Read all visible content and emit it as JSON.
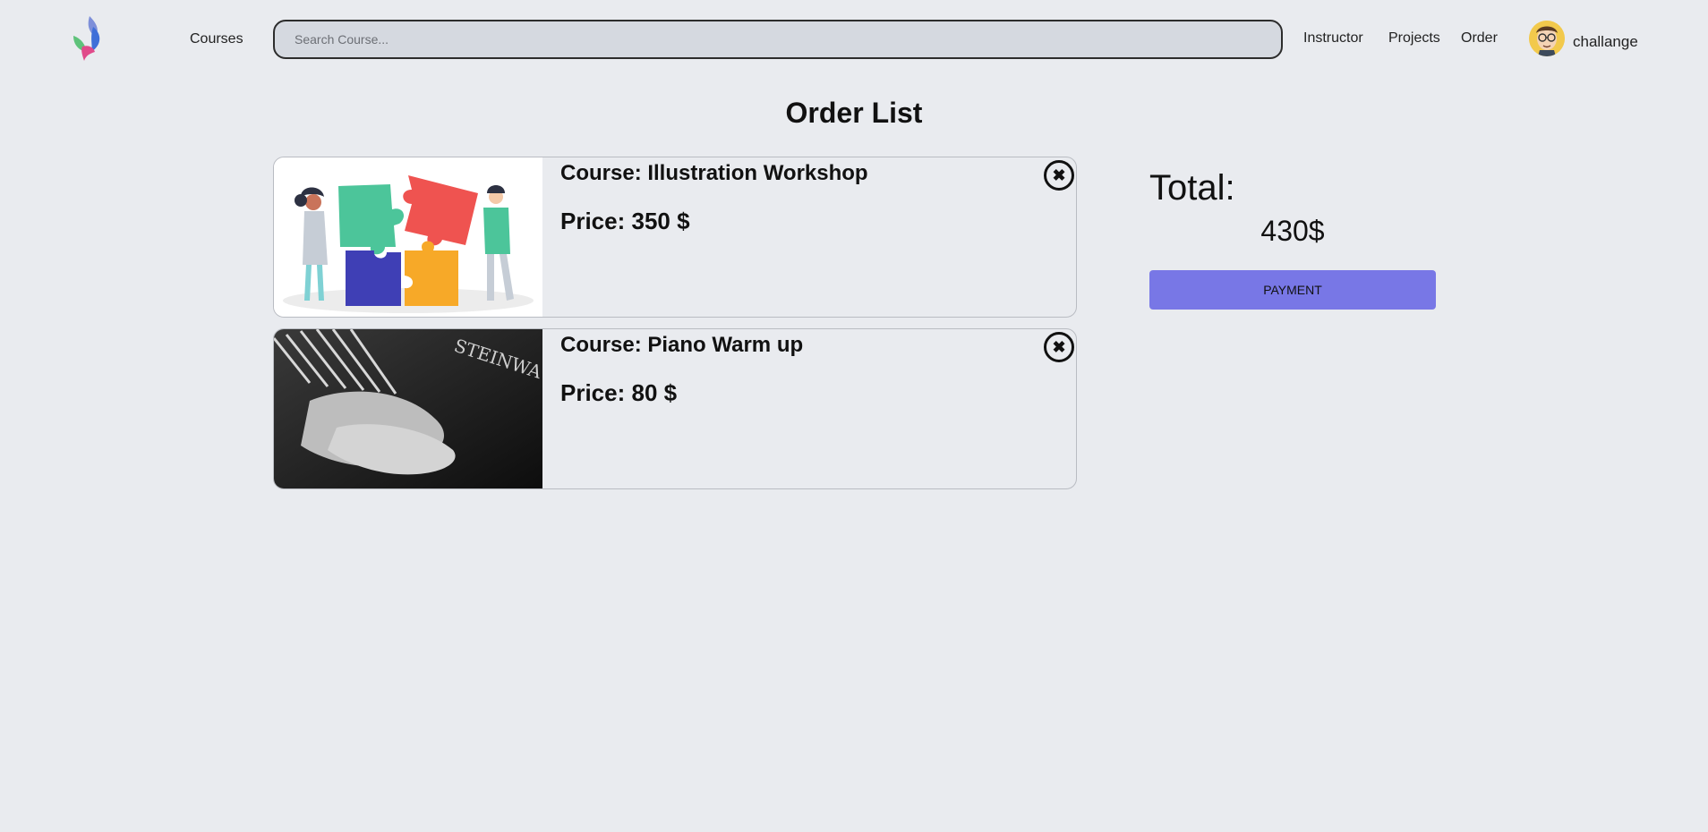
{
  "nav": {
    "courses_label": "Courses",
    "search_placeholder": "Search Course...",
    "search_value": "",
    "instructor_label": "Instructor",
    "projects_label": "Projects",
    "order_label": "Order",
    "username": "challange",
    "logo_icon": "flame-logo-icon",
    "avatar_icon": "user-avatar"
  },
  "page": {
    "title": "Order List"
  },
  "order_items": [
    {
      "title": "Course: Illustration Workshop",
      "price": "Price: 350 $",
      "thumbnail_icon": "puzzle-illustration",
      "remove_icon": "close-circle-icon",
      "remove_glyph": "✖"
    },
    {
      "title": "Course: Piano Warm up",
      "price": "Price: 80 $",
      "thumbnail_icon": "piano-photo",
      "thumbnail_text": "STEINWA",
      "remove_icon": "close-circle-icon",
      "remove_glyph": "✖"
    }
  ],
  "summary": {
    "total_label": "Total:",
    "total_value": "430$",
    "payment_label": "PAYMENT"
  },
  "colors": {
    "background": "#e9ebef",
    "search_bg": "#d5d9e0",
    "payment_button": "#7877e6"
  }
}
